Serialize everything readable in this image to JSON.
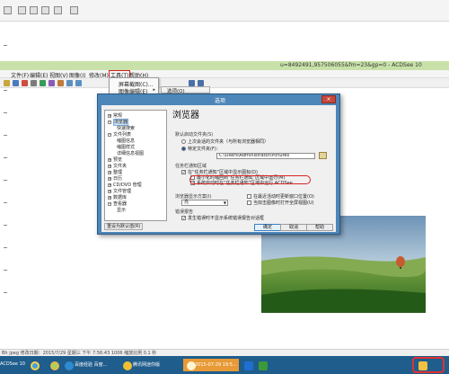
{
  "acdsee_title": "u=8492491,957506055&fm=23&gp=0 - ACDSee 10",
  "menu": {
    "items": [
      {
        "label": "文件(F)",
        "active": false
      },
      {
        "label": "编辑(E)",
        "active": false
      },
      {
        "label": "视图(V)",
        "active": false
      },
      {
        "label": "图像(I)",
        "active": false
      },
      {
        "label": "修改(M)",
        "active": false
      },
      {
        "label": "工具(T)",
        "active": true
      },
      {
        "label": "帮助(H)",
        "active": false
      }
    ]
  },
  "tools_menu": {
    "items": [
      {
        "label": "屏幕截图(C)..."
      },
      {
        "label": "图像编辑(E)"
      }
    ],
    "submenu_item": "选项(O)"
  },
  "dialog": {
    "title": "选项",
    "close_label": "×",
    "panel_title": "浏览器",
    "tree": [
      {
        "label": "常规",
        "level": 0,
        "expandable": true,
        "selected": false
      },
      {
        "label": "浏览器",
        "level": 0,
        "expandable": true,
        "selected": true
      },
      {
        "label": "快速搜索",
        "level": 1,
        "expandable": false,
        "selected": false
      },
      {
        "label": "文件列表",
        "level": 0,
        "expandable": true,
        "selected": false
      },
      {
        "label": "缩图信息",
        "level": 1,
        "expandable": false,
        "selected": false
      },
      {
        "label": "缩图样式",
        "level": 1,
        "expandable": false,
        "selected": false
      },
      {
        "label": "详细信息视图",
        "level": 1,
        "expandable": false,
        "selected": false
      },
      {
        "label": "预览",
        "level": 0,
        "expandable": true,
        "selected": false
      },
      {
        "label": "文件夹",
        "level": 0,
        "expandable": true,
        "selected": false
      },
      {
        "label": "整理",
        "level": 0,
        "expandable": true,
        "selected": false
      },
      {
        "label": "日历",
        "level": 0,
        "expandable": true,
        "selected": false
      },
      {
        "label": "CD/DVD 管理",
        "level": 0,
        "expandable": true,
        "selected": false
      },
      {
        "label": "文件管理",
        "level": 0,
        "expandable": true,
        "selected": false
      },
      {
        "label": "数据库",
        "level": 0,
        "expandable": true,
        "selected": false
      },
      {
        "label": "查看器",
        "level": 0,
        "expandable": true,
        "selected": false
      },
      {
        "label": "显示",
        "level": 1,
        "expandable": false,
        "selected": false
      }
    ],
    "reset_label": "重设为默认值(R)",
    "startup": {
      "section": "默认启动文件夹(S)",
      "option_last": "上次会话的文件夹（与所有浏览器相同）",
      "option_specific": "特定文件夹(F)：",
      "path": "C:\\Users\\Administrator\\Pictures"
    },
    "taskbar": {
      "section": "任务栏通知区域",
      "show_icon": "在“任务栏通知”区域中显示图标(D)",
      "minimize_to_tray": "最小化时缩回到“任务栏通知”区域中运行(M)",
      "close_to_tray": "系统启动时在“任务栏通知”区域中运行 ACDSee"
    },
    "display": {
      "section": "浏览器显示方案(I)",
      "scheme_value": "亮",
      "auto_scroll": "在最近活动时更新窗口位置(O)",
      "open_with_double_click": "当双击图像时打开全屏视图(U)"
    },
    "errors": {
      "section": "错误报告",
      "send_report": "发生错误时不显示系统错误报告对话框"
    },
    "buttons": {
      "ok": "确定",
      "cancel": "取消",
      "help": "帮助"
    }
  },
  "statusbar": {
    "text": "Bh jpeg    修改日期：2015/7/29 星期三 下午 7:56:43    1006    缩放比例 0.1 秒"
  },
  "taskbar": {
    "left_label": "ACDSee 10",
    "tasks": [
      {
        "label": "百度经验  百度...",
        "style": "normal"
      },
      {
        "label": "腾讯网迷你版",
        "style": "normal"
      },
      {
        "label": "2015-07-29 19:5...",
        "style": "orange"
      }
    ]
  },
  "colors": {
    "acd_title_bg": "#c8e1a8",
    "dialog_frame": "#4d86b8",
    "taskbar_bg": "#1f5d8c",
    "highlight_ring": "#d22222"
  }
}
